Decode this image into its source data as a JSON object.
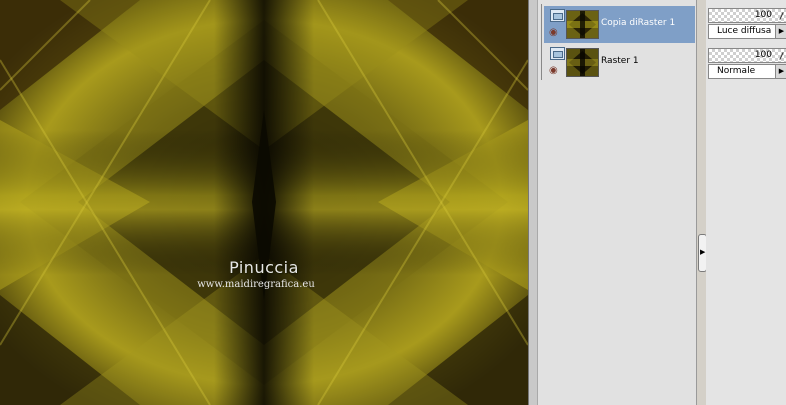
{
  "canvas": {
    "watermark_title": "Pinuccia",
    "watermark_url": "www.maidiregrafica.eu",
    "colors": {
      "yellow": "#b4ad1e",
      "olive": "#6a6215",
      "dark": "#0d0c02",
      "brown": "#5a3a10"
    }
  },
  "layers": [
    {
      "name": "Copia diRaster 1",
      "selected": true,
      "visible_icon": "eye-icon",
      "type_icon": "raster-layer-icon",
      "opacity": "100",
      "blend_mode": "Luce diffusa"
    },
    {
      "name": "Raster 1",
      "selected": false,
      "visible_icon": "eye-icon",
      "type_icon": "raster-layer-icon",
      "opacity": "100",
      "blend_mode": "Normale"
    }
  ],
  "colors": {
    "selection": "#7f9fc7",
    "panel_bg": "#e1e1e1"
  }
}
